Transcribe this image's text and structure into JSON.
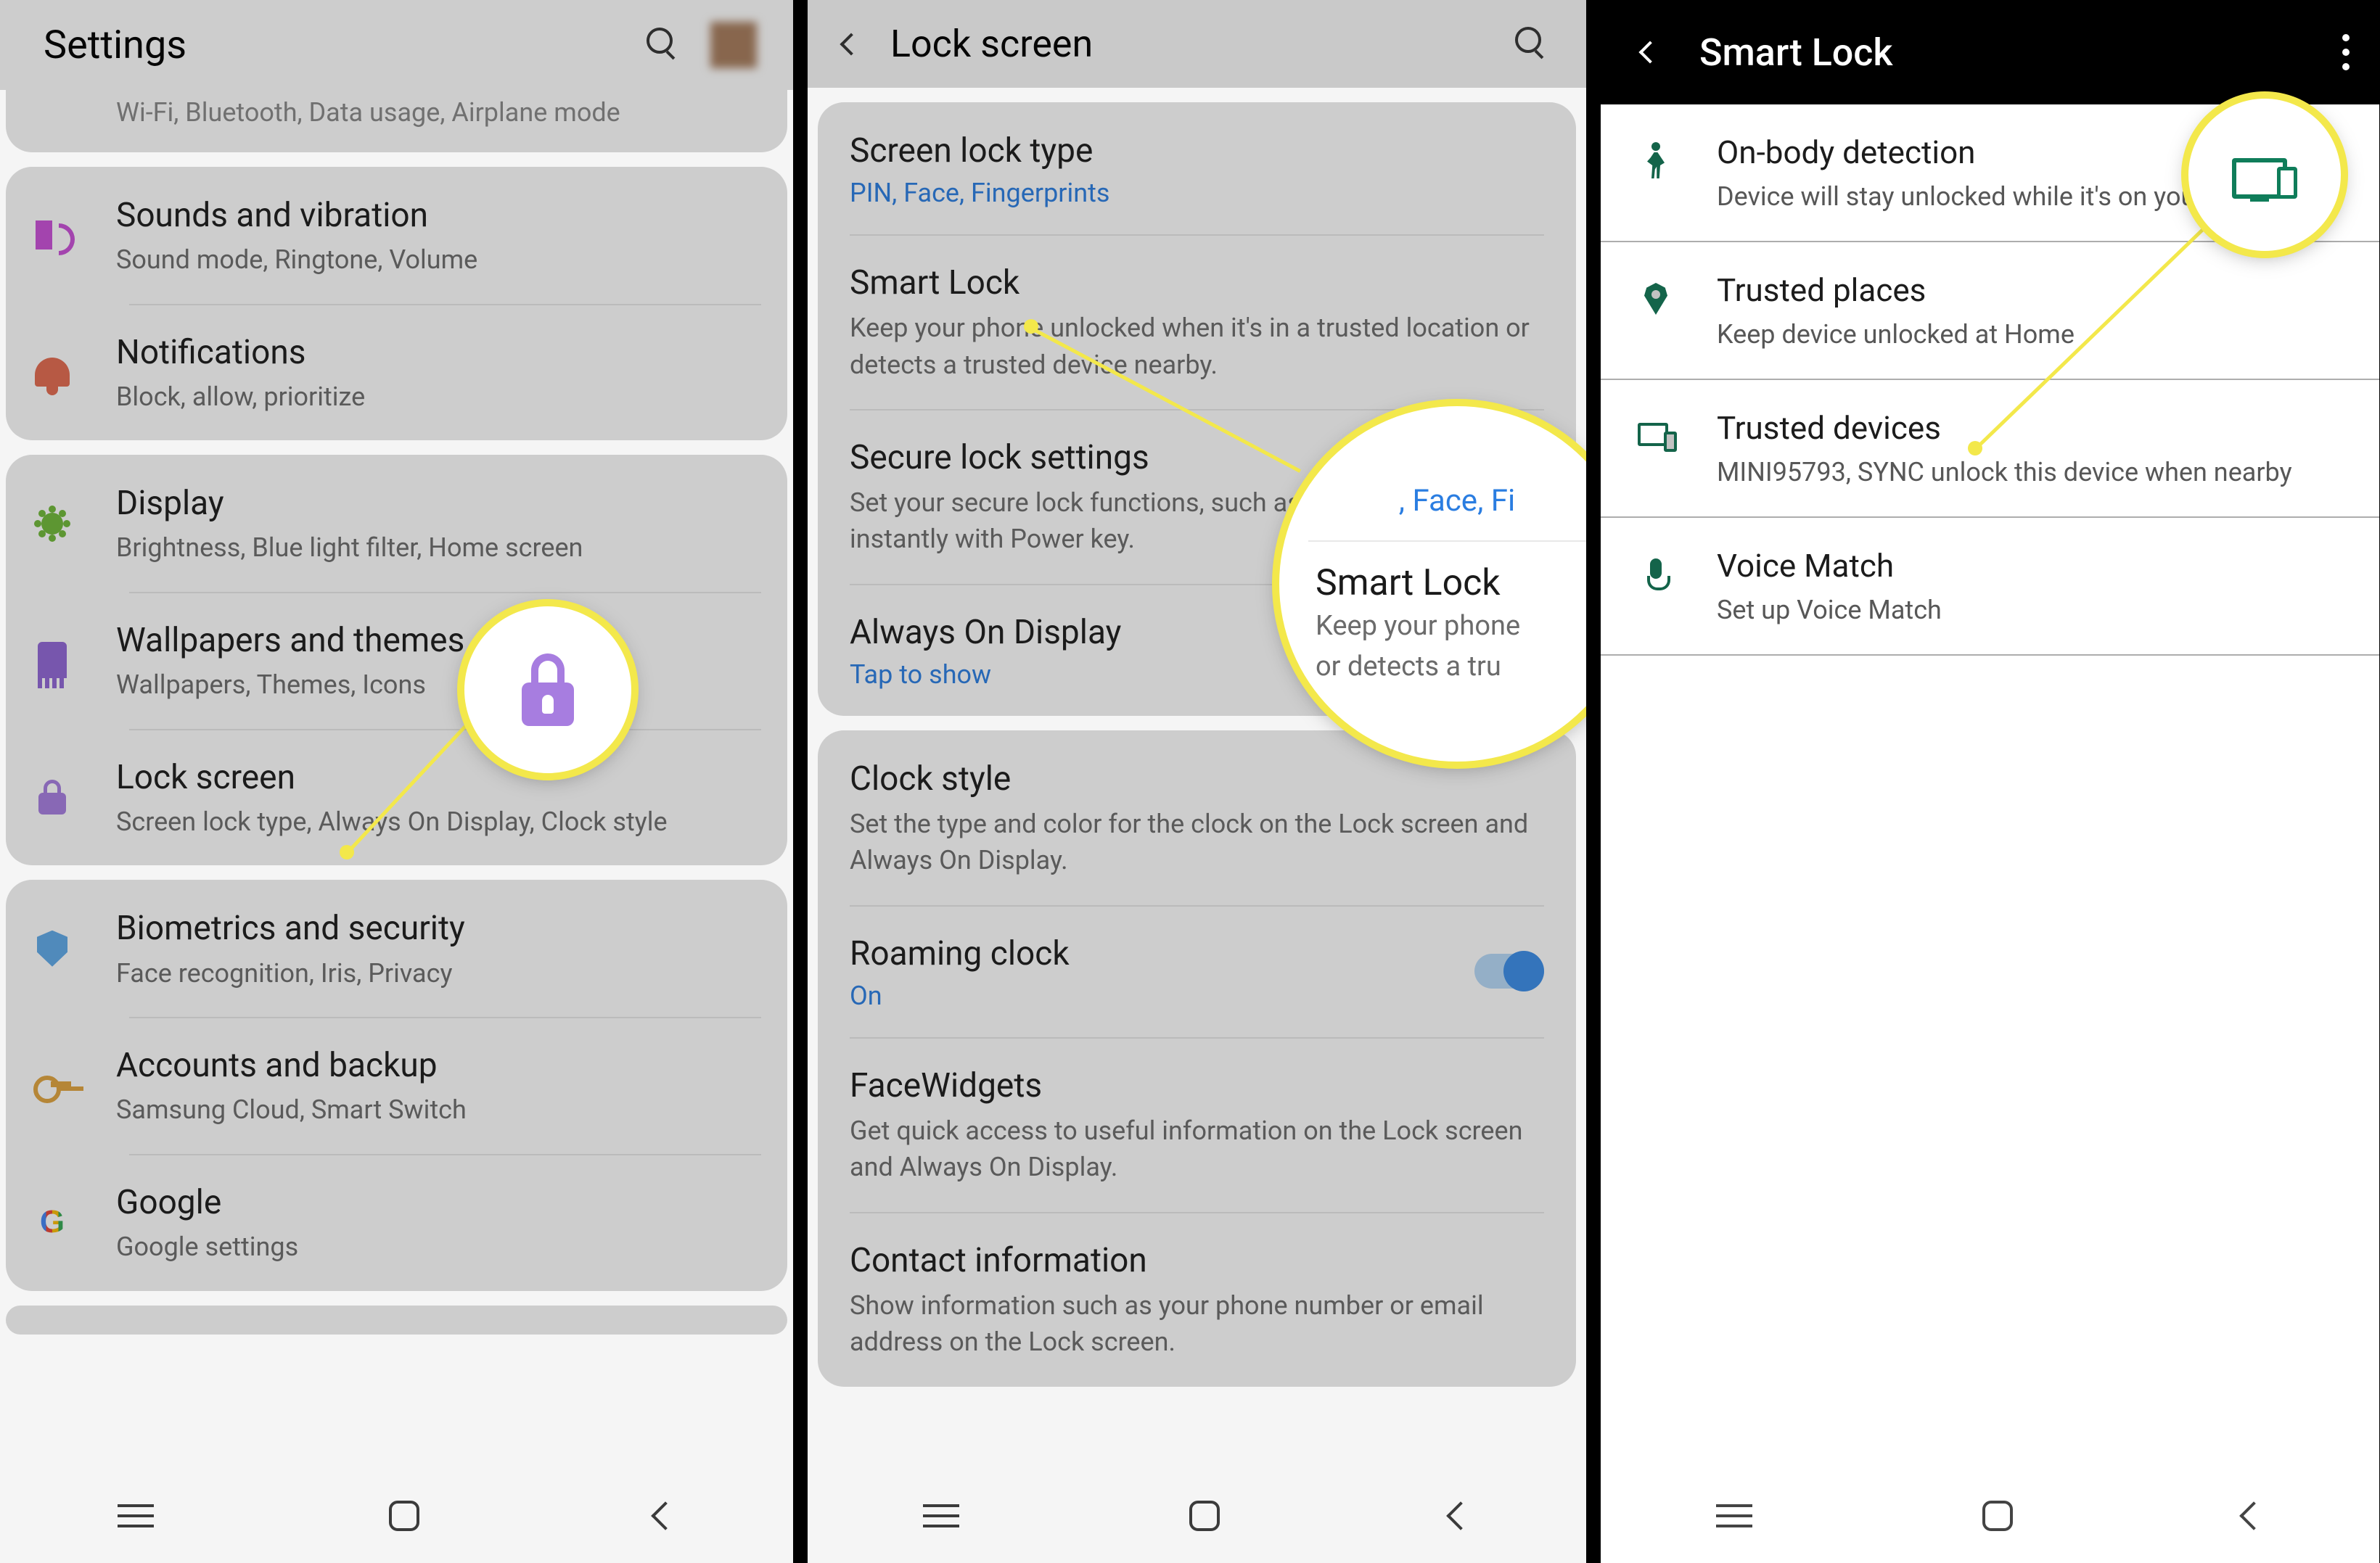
{
  "screen1": {
    "title": "Settings",
    "partial_top": "Wi-Fi, Bluetooth, Data usage, Airplane mode",
    "group1": [
      {
        "icon": "speaker-icon",
        "title": "Sounds and vibration",
        "sub": "Sound mode, Ringtone, Volume"
      },
      {
        "icon": "bell-icon",
        "title": "Notifications",
        "sub": "Block, allow, prioritize"
      }
    ],
    "group2": [
      {
        "icon": "sun-icon",
        "title": "Display",
        "sub": "Brightness, Blue light filter, Home screen"
      },
      {
        "icon": "brush-icon",
        "title": "Wallpapers and themes",
        "sub": "Wallpapers, Themes, Icons"
      },
      {
        "icon": "lock-icon",
        "title": "Lock screen",
        "sub": "Screen lock type, Always On Display, Clock style"
      }
    ],
    "group3": [
      {
        "icon": "shield-icon",
        "title": "Biometrics and security",
        "sub": "Face recognition, Iris, Privacy"
      },
      {
        "icon": "key-icon",
        "title": "Accounts and backup",
        "sub": "Samsung Cloud, Smart Switch"
      },
      {
        "icon": "google-icon",
        "title": "Google",
        "sub": "Google settings"
      }
    ]
  },
  "screen2": {
    "title": "Lock screen",
    "group1": [
      {
        "title": "Screen lock type",
        "sub": "PIN, Face, Fingerprints",
        "blue": true
      },
      {
        "title": "Smart Lock",
        "sub": "Keep your phone unlocked when it's in a trusted location or detects a trusted device nearby."
      },
      {
        "title": "Secure lock settings",
        "sub": "Set your secure lock functions, such as Auto lock and Lock instantly with Power key."
      },
      {
        "title": "Always On Display",
        "sub": "Tap to show",
        "blue": true
      }
    ],
    "group2": [
      {
        "title": "Clock style",
        "sub": "Set the type and color for the clock on the Lock screen and Always On Display."
      },
      {
        "title": "Roaming clock",
        "sub": "On",
        "blue": true,
        "toggle": true
      },
      {
        "title": "FaceWidgets",
        "sub": "Get quick access to useful information on the Lock screen and Always On Display."
      },
      {
        "title": "Contact information",
        "sub": "Show information such as your phone number or email address on the Lock screen."
      }
    ]
  },
  "screen3": {
    "title": "Smart Lock",
    "items": [
      {
        "icon": "walk-icon",
        "title": "On-body detection",
        "sub": "Device will stay unlocked while it's on you."
      },
      {
        "icon": "pin-icon",
        "title": "Trusted places",
        "sub": "Keep device unlocked at Home"
      },
      {
        "icon": "devices-icon",
        "title": "Trusted devices",
        "sub": "MINI95793, SYNC unlock this device when nearby"
      },
      {
        "icon": "mic-icon",
        "title": "Voice Match",
        "sub": "Set up Voice Match"
      }
    ]
  },
  "callout2": {
    "top_partial": ", Face, Fi",
    "title": "Smart Lock",
    "sub1": "Keep your phone",
    "sub2": "or detects a tru"
  }
}
